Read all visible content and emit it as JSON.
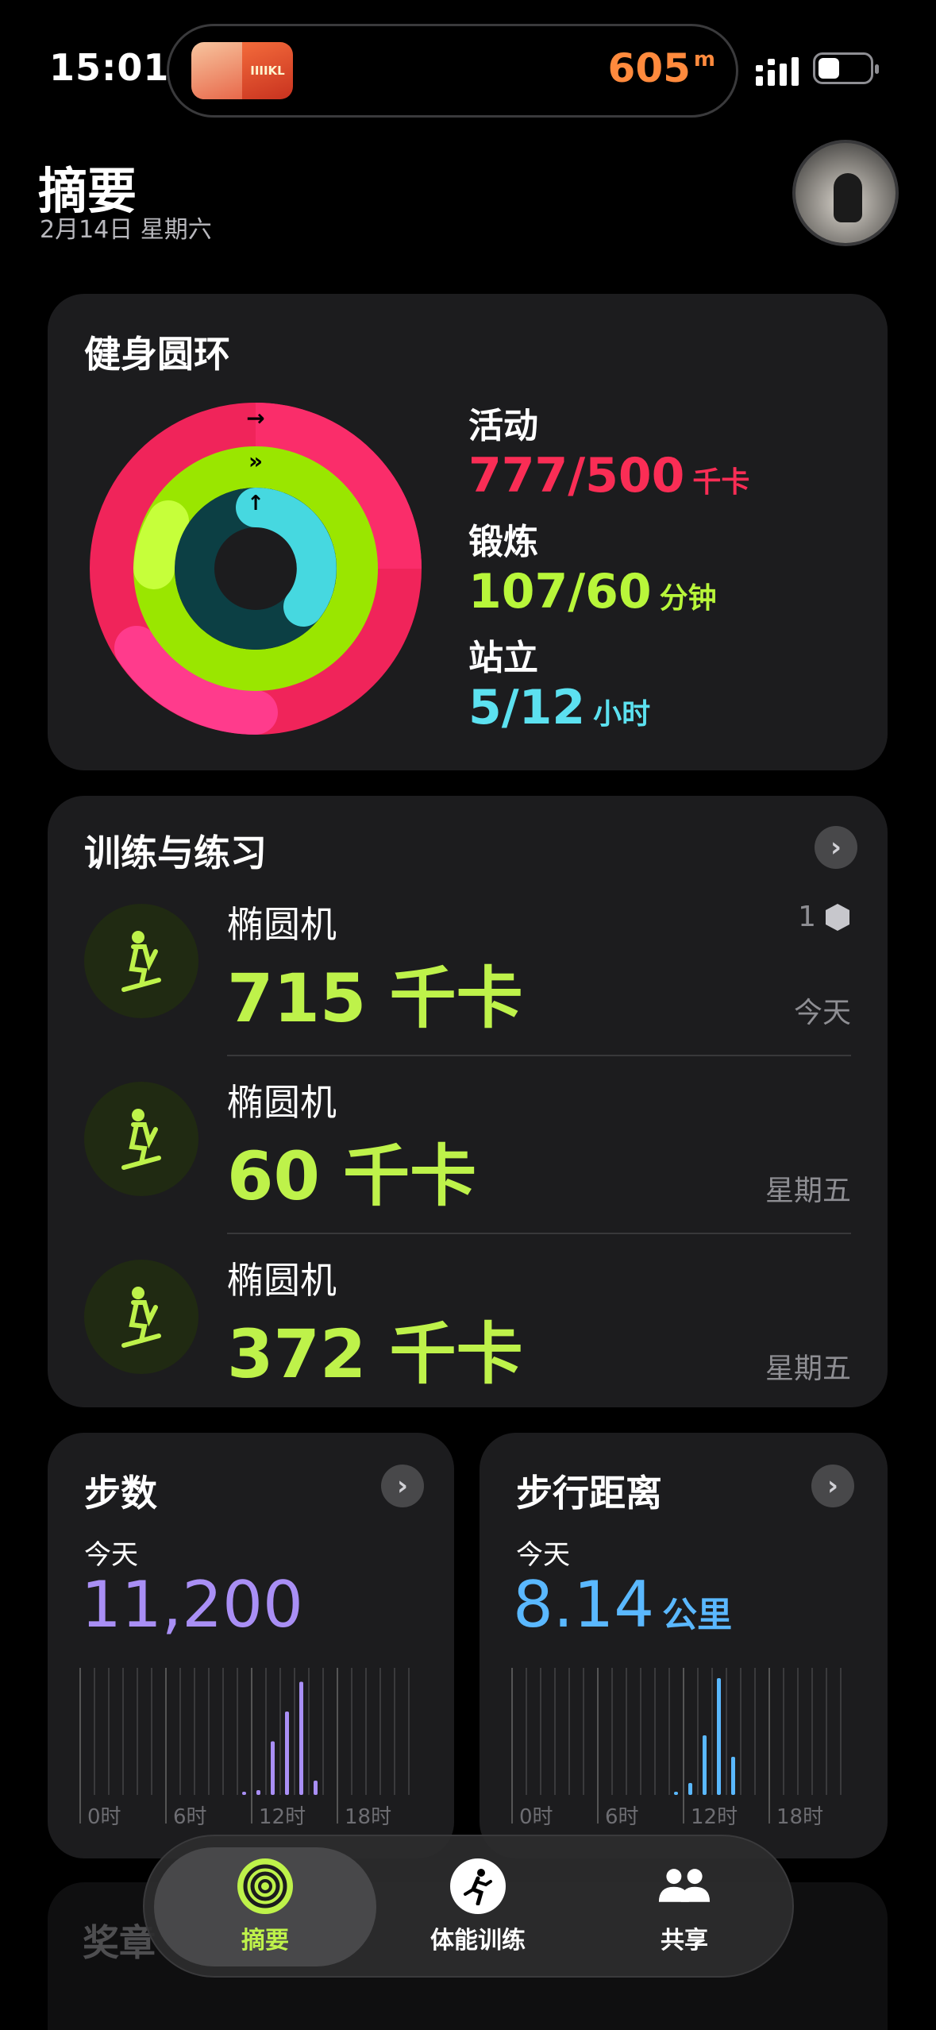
{
  "status": {
    "time": "15:01",
    "distance": "605",
    "distance_unit": "m",
    "island_app_text": "IIIIKL"
  },
  "header": {
    "title": "摘要",
    "date": "2月14日 星期六"
  },
  "rings": {
    "title": "健身圆环",
    "move": {
      "label": "活动",
      "value": "777/500",
      "unit": "千卡",
      "progress": 1.554,
      "color": "#fa114f"
    },
    "exercise": {
      "label": "锻炼",
      "value": "107/60",
      "unit": "分钟",
      "progress": 1.783,
      "color": "#a6ff00"
    },
    "stand": {
      "label": "站立",
      "value": "5/12",
      "unit": "小时",
      "progress": 0.417,
      "color": "#00fff6"
    }
  },
  "workouts": {
    "title": "训练与练习",
    "items": [
      {
        "name": "椭圆机",
        "value": "715 千卡",
        "date": "今天",
        "badge": "1"
      },
      {
        "name": "椭圆机",
        "value": "60 千卡",
        "date": "星期五",
        "badge": ""
      },
      {
        "name": "椭圆机",
        "value": "372 千卡",
        "date": "星期五",
        "badge": ""
      }
    ]
  },
  "steps": {
    "title": "步数",
    "sub": "今天",
    "value": "11,200",
    "color": "#a98ff5",
    "axis": [
      "0时",
      "6时",
      "12时",
      "18时"
    ],
    "bars": [
      0,
      0,
      0,
      0,
      0,
      0,
      0,
      0,
      0,
      0,
      0,
      0.02,
      0.04,
      0.45,
      0.7,
      0.95,
      0.12,
      0,
      0,
      0,
      0,
      0,
      0,
      0
    ]
  },
  "distance": {
    "title": "步行距离",
    "sub": "今天",
    "value": "8.14",
    "unit": "公里",
    "color": "#5ab8ff",
    "axis": [
      "0时",
      "6时",
      "12时",
      "18时"
    ],
    "bars": [
      0,
      0,
      0,
      0,
      0,
      0,
      0,
      0,
      0,
      0,
      0,
      0.02,
      0.1,
      0.5,
      0.98,
      0.32,
      0,
      0,
      0,
      0,
      0,
      0,
      0,
      0
    ]
  },
  "awards": {
    "title": "奖章"
  },
  "tabbar": {
    "tabs": [
      {
        "label": "摘要",
        "icon": "activity-rings-icon",
        "active": true
      },
      {
        "label": "体能训练",
        "icon": "running-figure-icon",
        "active": false
      },
      {
        "label": "共享",
        "icon": "people-icon",
        "active": false
      }
    ]
  }
}
